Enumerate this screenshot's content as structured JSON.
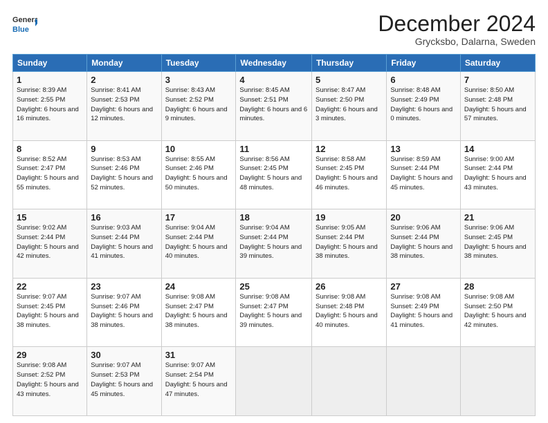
{
  "header": {
    "logo_line1": "General",
    "logo_line2": "Blue",
    "month": "December 2024",
    "location": "Grycksbo, Dalarna, Sweden"
  },
  "weekdays": [
    "Sunday",
    "Monday",
    "Tuesday",
    "Wednesday",
    "Thursday",
    "Friday",
    "Saturday"
  ],
  "weeks": [
    [
      {
        "day": "1",
        "details": "Sunrise: 8:39 AM\nSunset: 2:55 PM\nDaylight: 6 hours and 16 minutes."
      },
      {
        "day": "2",
        "details": "Sunrise: 8:41 AM\nSunset: 2:53 PM\nDaylight: 6 hours and 12 minutes."
      },
      {
        "day": "3",
        "details": "Sunrise: 8:43 AM\nSunset: 2:52 PM\nDaylight: 6 hours and 9 minutes."
      },
      {
        "day": "4",
        "details": "Sunrise: 8:45 AM\nSunset: 2:51 PM\nDaylight: 6 hours and 6 minutes."
      },
      {
        "day": "5",
        "details": "Sunrise: 8:47 AM\nSunset: 2:50 PM\nDaylight: 6 hours and 3 minutes."
      },
      {
        "day": "6",
        "details": "Sunrise: 8:48 AM\nSunset: 2:49 PM\nDaylight: 6 hours and 0 minutes."
      },
      {
        "day": "7",
        "details": "Sunrise: 8:50 AM\nSunset: 2:48 PM\nDaylight: 5 hours and 57 minutes."
      }
    ],
    [
      {
        "day": "8",
        "details": "Sunrise: 8:52 AM\nSunset: 2:47 PM\nDaylight: 5 hours and 55 minutes."
      },
      {
        "day": "9",
        "details": "Sunrise: 8:53 AM\nSunset: 2:46 PM\nDaylight: 5 hours and 52 minutes."
      },
      {
        "day": "10",
        "details": "Sunrise: 8:55 AM\nSunset: 2:46 PM\nDaylight: 5 hours and 50 minutes."
      },
      {
        "day": "11",
        "details": "Sunrise: 8:56 AM\nSunset: 2:45 PM\nDaylight: 5 hours and 48 minutes."
      },
      {
        "day": "12",
        "details": "Sunrise: 8:58 AM\nSunset: 2:45 PM\nDaylight: 5 hours and 46 minutes."
      },
      {
        "day": "13",
        "details": "Sunrise: 8:59 AM\nSunset: 2:44 PM\nDaylight: 5 hours and 45 minutes."
      },
      {
        "day": "14",
        "details": "Sunrise: 9:00 AM\nSunset: 2:44 PM\nDaylight: 5 hours and 43 minutes."
      }
    ],
    [
      {
        "day": "15",
        "details": "Sunrise: 9:02 AM\nSunset: 2:44 PM\nDaylight: 5 hours and 42 minutes."
      },
      {
        "day": "16",
        "details": "Sunrise: 9:03 AM\nSunset: 2:44 PM\nDaylight: 5 hours and 41 minutes."
      },
      {
        "day": "17",
        "details": "Sunrise: 9:04 AM\nSunset: 2:44 PM\nDaylight: 5 hours and 40 minutes."
      },
      {
        "day": "18",
        "details": "Sunrise: 9:04 AM\nSunset: 2:44 PM\nDaylight: 5 hours and 39 minutes."
      },
      {
        "day": "19",
        "details": "Sunrise: 9:05 AM\nSunset: 2:44 PM\nDaylight: 5 hours and 38 minutes."
      },
      {
        "day": "20",
        "details": "Sunrise: 9:06 AM\nSunset: 2:44 PM\nDaylight: 5 hours and 38 minutes."
      },
      {
        "day": "21",
        "details": "Sunrise: 9:06 AM\nSunset: 2:45 PM\nDaylight: 5 hours and 38 minutes."
      }
    ],
    [
      {
        "day": "22",
        "details": "Sunrise: 9:07 AM\nSunset: 2:45 PM\nDaylight: 5 hours and 38 minutes."
      },
      {
        "day": "23",
        "details": "Sunrise: 9:07 AM\nSunset: 2:46 PM\nDaylight: 5 hours and 38 minutes."
      },
      {
        "day": "24",
        "details": "Sunrise: 9:08 AM\nSunset: 2:47 PM\nDaylight: 5 hours and 38 minutes."
      },
      {
        "day": "25",
        "details": "Sunrise: 9:08 AM\nSunset: 2:47 PM\nDaylight: 5 hours and 39 minutes."
      },
      {
        "day": "26",
        "details": "Sunrise: 9:08 AM\nSunset: 2:48 PM\nDaylight: 5 hours and 40 minutes."
      },
      {
        "day": "27",
        "details": "Sunrise: 9:08 AM\nSunset: 2:49 PM\nDaylight: 5 hours and 41 minutes."
      },
      {
        "day": "28",
        "details": "Sunrise: 9:08 AM\nSunset: 2:50 PM\nDaylight: 5 hours and 42 minutes."
      }
    ],
    [
      {
        "day": "29",
        "details": "Sunrise: 9:08 AM\nSunset: 2:52 PM\nDaylight: 5 hours and 43 minutes."
      },
      {
        "day": "30",
        "details": "Sunrise: 9:07 AM\nSunset: 2:53 PM\nDaylight: 5 hours and 45 minutes."
      },
      {
        "day": "31",
        "details": "Sunrise: 9:07 AM\nSunset: 2:54 PM\nDaylight: 5 hours and 47 minutes."
      },
      {
        "day": "",
        "details": ""
      },
      {
        "day": "",
        "details": ""
      },
      {
        "day": "",
        "details": ""
      },
      {
        "day": "",
        "details": ""
      }
    ]
  ]
}
